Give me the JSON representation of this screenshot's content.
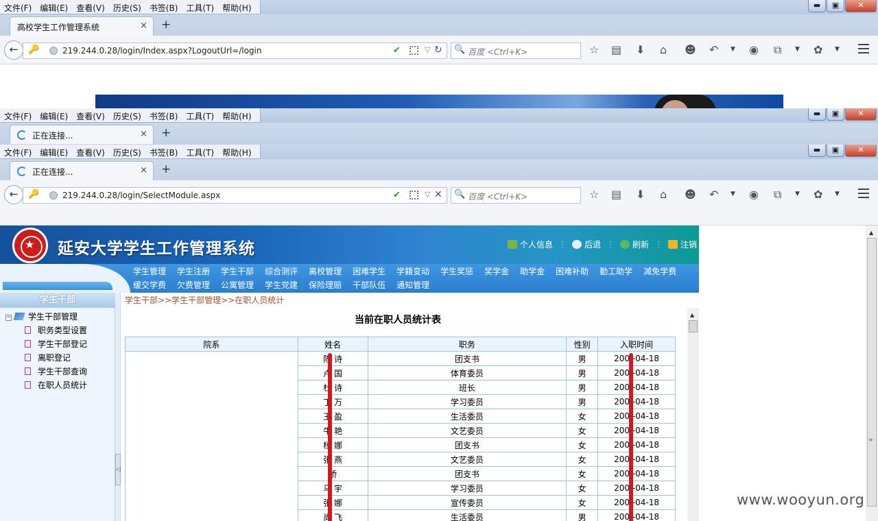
{
  "menus": [
    "文件(F)",
    "编辑(E)",
    "查看(V)",
    "历史(S)",
    "书签(B)",
    "工具(T)",
    "帮助(H)"
  ],
  "window_controls": {
    "min": "▬",
    "max": "▣",
    "close": "✕"
  },
  "windows": [
    {
      "tab_title": "高校学生工作管理系统",
      "loading": false,
      "url": "219.244.0.28/login/Index.aspx?LogoutUrl=/login",
      "url_action_icon": "reload-icon"
    },
    {
      "tab_title": "正在连接...",
      "loading": true
    },
    {
      "tab_title": "正在连接...",
      "loading": true,
      "url": "219.244.0.28/login/SelectModule.aspx",
      "url_action_icon": "stop-icon"
    }
  ],
  "search_placeholder": "百度 <Ctrl+K>",
  "tab_close": "×",
  "new_tab": "+",
  "app": {
    "title": "延安大学学生工作管理系统",
    "header_links": [
      "个人信息",
      "后退",
      "刷新",
      "注销"
    ],
    "nav_items": [
      "学生管理",
      "学生注册",
      "学生干部",
      "综合测评",
      "离校管理",
      "困难学生",
      "学籍变动",
      "学生奖惩",
      "奖学金",
      "助学金",
      "困难补助",
      "勤工助学",
      "减免学费",
      "缓交学费",
      "欠费管理",
      "公寓管理",
      "学生党建",
      "保险理赔",
      "干部队伍",
      "通知管理"
    ],
    "sidebar": {
      "title": "学生干部",
      "tree_root": "学生干部管理",
      "tree_expander": "−",
      "items": [
        "职务类型设置",
        "学生干部登记",
        "离职登记",
        "学生干部查询",
        "在职人员统计"
      ]
    },
    "breadcrumb": "学生干部>>学生干部管理>>在职人员统计",
    "table_title": "当前在职人员统计表",
    "table_headers": [
      "院系",
      "姓名",
      "职务",
      "性别",
      "入职时间"
    ],
    "rows": [
      {
        "name": "陈 诗",
        "role": "团支书",
        "gender": "男",
        "date": "200 -04-18"
      },
      {
        "name": "卢 国",
        "role": "体育委员",
        "gender": "男",
        "date": "200 -04-18"
      },
      {
        "name": "杜 诗",
        "role": "班长",
        "gender": "男",
        "date": "200 -04-18"
      },
      {
        "name": "丁 万",
        "role": "学习委员",
        "gender": "男",
        "date": "200 -04-18"
      },
      {
        "name": "王 盈",
        "role": "生活委员",
        "gender": "女",
        "date": "200 -04-18"
      },
      {
        "name": "牛 艳",
        "role": "文艺委员",
        "gender": "女",
        "date": "200 -04-18"
      },
      {
        "name": "杨 娜",
        "role": "团支书",
        "gender": "女",
        "date": "200 -04-18"
      },
      {
        "name": "张 燕",
        "role": "文艺委员",
        "gender": "女",
        "date": "200 -04-18"
      },
      {
        "name": " 桥",
        "role": "团支书",
        "gender": "女",
        "date": "200 -04-18"
      },
      {
        "name": "马 宇",
        "role": "学习委员",
        "gender": "女",
        "date": "200 -04-18"
      },
      {
        "name": "张 娜",
        "role": "宣传委员",
        "gender": "女",
        "date": "200 -04-18"
      },
      {
        "name": "尚 飞",
        "role": "生活委员",
        "gender": "男",
        "date": "200 -04-18"
      }
    ]
  },
  "watermark": "www.wooyun.org",
  "colors": {
    "header_blue": "#1a66b8",
    "nav_blue": "#2a7fcf",
    "redaction": "#d4181e",
    "breadcrumb": "#a0522d",
    "table_border": "#9cc7e4"
  }
}
